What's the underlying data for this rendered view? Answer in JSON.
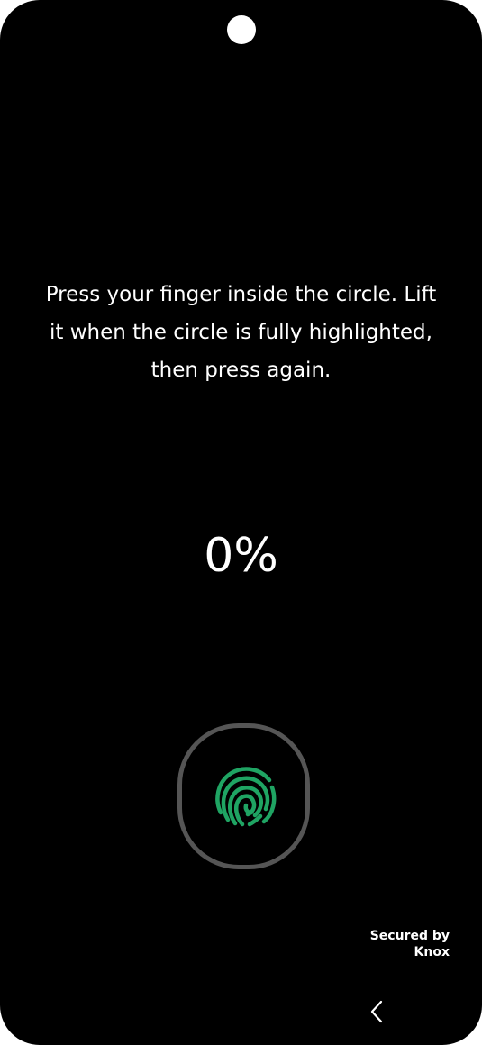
{
  "enrollment": {
    "instruction": "Press your finger inside the circle. Lift\nit when the circle is fully highlighted,\nthen press again.",
    "progress_text": "0%",
    "progress_value": 0
  },
  "sensor": {
    "icon": "fingerprint-icon",
    "icon_color": "#1fa463",
    "ring_color": "#555555"
  },
  "footer": {
    "secured_line1": "Secured by",
    "secured_line2": "Knox"
  },
  "nav": {
    "back_icon": "chevron-left-icon"
  },
  "colors": {
    "background": "#000000",
    "text": "#ffffff"
  }
}
